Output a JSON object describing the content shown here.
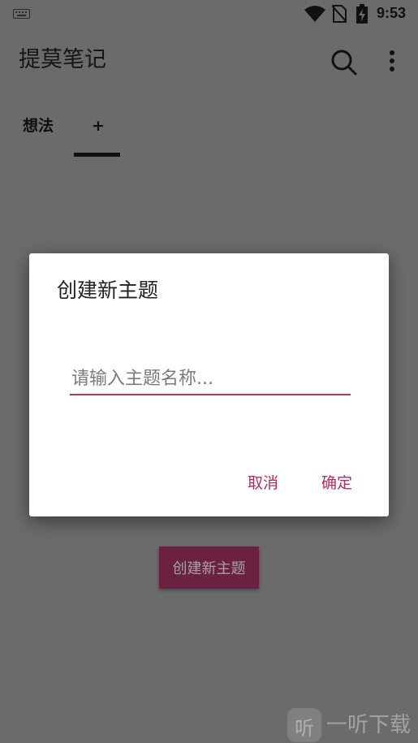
{
  "status_bar": {
    "time": "9:53",
    "icons": [
      "keyboard-icon",
      "wifi-icon",
      "no-sim-icon",
      "battery-charging-icon"
    ]
  },
  "app_bar": {
    "title": "提莫笔记",
    "icons": [
      "search-icon",
      "more-vert-icon"
    ]
  },
  "tabs": [
    {
      "label": "想法",
      "selected": false
    },
    {
      "label": "+",
      "selected": true
    }
  ],
  "background_button": {
    "label": "创建新主题"
  },
  "dialog": {
    "title": "创建新主题",
    "input": {
      "value": "",
      "placeholder": "请输入主题名称..."
    },
    "cancel_label": "取消",
    "confirm_label": "确定"
  },
  "watermark": {
    "logo_char": "听",
    "text": "一听下载"
  },
  "colors": {
    "accent": "#b22d63",
    "background_scrim": "#6b6b6b",
    "dialog_bg": "#ffffff",
    "button_bg": "#6a2240"
  }
}
